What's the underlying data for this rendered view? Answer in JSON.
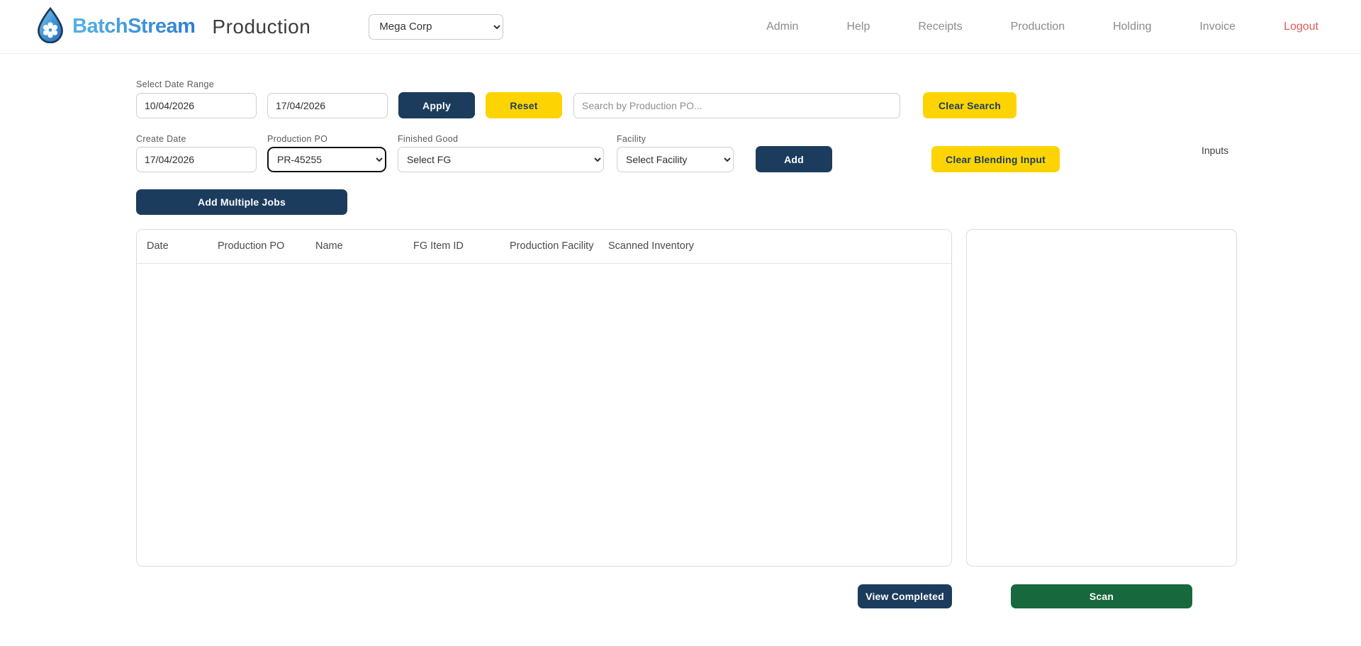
{
  "header": {
    "logo_text": "BatchStream",
    "page_title": "Production",
    "company_select": {
      "value": "Mega Corp"
    },
    "nav": [
      {
        "label": "Admin"
      },
      {
        "label": "Help"
      },
      {
        "label": "Receipts"
      },
      {
        "label": "Production"
      },
      {
        "label": "Holding"
      },
      {
        "label": "Invoice"
      },
      {
        "label": "Logout"
      }
    ]
  },
  "filters": {
    "date_range_label": "Select Date Range",
    "date_from": "10/04/2026",
    "date_to": "17/04/2026",
    "apply_label": "Apply",
    "reset_label": "Reset",
    "search_placeholder": "Search by Production PO...",
    "clear_search_label": "Clear Search"
  },
  "job_form": {
    "create_date_label": "Create Date",
    "create_date_value": "17/04/2026",
    "production_po_label": "Production PO",
    "production_po_value": "PR-45255",
    "finished_good_label": "Finished Good",
    "finished_good_value": "Select FG",
    "facility_label": "Facility",
    "facility_value": "Select Facility",
    "add_label": "Add",
    "clear_blending_label": "Clear Blending Input",
    "inputs_label": "Inputs",
    "add_multiple_label": "Add Multiple Jobs"
  },
  "jobs_table": {
    "columns": [
      "Date",
      "Production PO",
      "Name",
      "FG Item ID",
      "Production Facility",
      "Scanned Inventory"
    ],
    "rows": []
  },
  "actions": {
    "view_completed_label": "View Completed",
    "scan_label": "Scan"
  },
  "colors": {
    "navy": "#1c3c5e",
    "yellow": "#fdd402",
    "green": "#17693d",
    "logout_red": "#e05a55",
    "brand_blue": "#3b97dc"
  }
}
